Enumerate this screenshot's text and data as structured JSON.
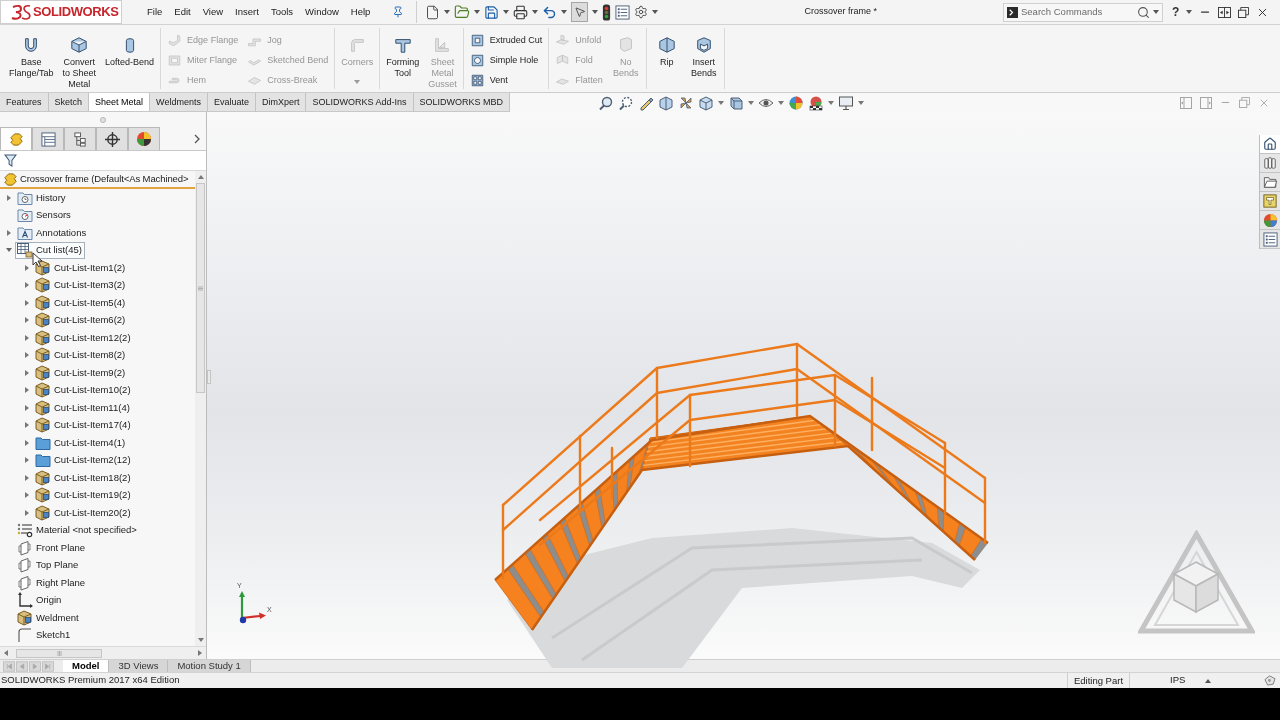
{
  "title_bar": {
    "logo": "SOLIDWORKS",
    "menu": [
      "File",
      "Edit",
      "View",
      "Insert",
      "Tools",
      "Window",
      "Help"
    ],
    "document_title": "Crossover frame *",
    "search": {
      "placeholder": "Search Commands"
    },
    "help": "?"
  },
  "ribbon": {
    "groups": [
      {
        "columns": [
          {
            "kind": "large",
            "label": "Base\nFlange/Tab",
            "disabled": false,
            "dropdown": false
          },
          {
            "kind": "large",
            "label": "Convert\nto Sheet\nMetal",
            "disabled": false,
            "dropdown": false
          },
          {
            "kind": "large",
            "label": "Lofted-Bend",
            "disabled": false,
            "dropdown": false
          }
        ]
      },
      {
        "columns": [
          {
            "kind": "stack",
            "items": [
              {
                "label": "Edge Flange",
                "disabled": true
              },
              {
                "label": "Miter Flange",
                "disabled": true
              },
              {
                "label": "Hem",
                "disabled": true
              }
            ]
          },
          {
            "kind": "stack",
            "items": [
              {
                "label": "Jog",
                "disabled": true
              },
              {
                "label": "Sketched Bend",
                "disabled": true
              },
              {
                "label": "Cross-Break",
                "disabled": true
              }
            ]
          }
        ]
      },
      {
        "columns": [
          {
            "kind": "large",
            "label": "Corners",
            "disabled": true,
            "dropdown": true
          }
        ]
      },
      {
        "columns": [
          {
            "kind": "large",
            "label": "Forming\nTool",
            "disabled": false,
            "dropdown": false
          },
          {
            "kind": "large",
            "label": "Sheet\nMetal\nGusset",
            "disabled": true,
            "dropdown": false
          }
        ]
      },
      {
        "columns": [
          {
            "kind": "stack",
            "items": [
              {
                "label": "Extruded Cut",
                "disabled": false
              },
              {
                "label": "Simple Hole",
                "disabled": false
              },
              {
                "label": "Vent",
                "disabled": false
              }
            ]
          }
        ]
      },
      {
        "columns": [
          {
            "kind": "stack",
            "items": [
              {
                "label": "Unfold",
                "disabled": true
              },
              {
                "label": "Fold",
                "disabled": true
              },
              {
                "label": "Flatten",
                "disabled": true
              }
            ]
          },
          {
            "kind": "large",
            "label": "No\nBends",
            "disabled": true,
            "dropdown": false
          }
        ]
      },
      {
        "columns": [
          {
            "kind": "large",
            "label": "Rip",
            "disabled": false,
            "dropdown": false
          },
          {
            "kind": "large",
            "label": "Insert\nBends",
            "disabled": false,
            "dropdown": false
          }
        ]
      }
    ]
  },
  "command_tabs": [
    {
      "label": "Features",
      "selected": false
    },
    {
      "label": "Sketch",
      "selected": false
    },
    {
      "label": "Sheet Metal",
      "selected": true
    },
    {
      "label": "Weldments",
      "selected": false
    },
    {
      "label": "Evaluate",
      "selected": false
    },
    {
      "label": "DimXpert",
      "selected": false
    },
    {
      "label": "SOLIDWORKS Add-Ins",
      "selected": false
    },
    {
      "label": "SOLIDWORKS MBD",
      "selected": false
    }
  ],
  "feature_manager": {
    "panel_tabs": [
      {
        "selected": true
      },
      {
        "selected": false
      },
      {
        "selected": false
      },
      {
        "selected": false
      },
      {
        "selected": false
      }
    ],
    "tree": {
      "root": "Crossover frame (Default<As Machined>",
      "items": [
        {
          "label": "History",
          "kind": "history",
          "expanded": false,
          "highlighted": false
        },
        {
          "label": "Sensors",
          "kind": "sensors",
          "highlighted": false
        },
        {
          "label": "Annotations",
          "kind": "annotations",
          "expanded": false,
          "highlighted": false
        },
        {
          "label": "Cut list(45)",
          "kind": "cut-list",
          "expanded": true,
          "highlighted": true,
          "children": [
            {
              "label": "Cut-List-Item1(2)",
              "kind": "cut-item",
              "expanded": false,
              "highlighted": false
            },
            {
              "label": "Cut-List-Item3(2)",
              "kind": "cut-item",
              "expanded": false,
              "highlighted": false
            },
            {
              "label": "Cut-List-Item5(4)",
              "kind": "cut-item",
              "expanded": false,
              "highlighted": false
            },
            {
              "label": "Cut-List-Item6(2)",
              "kind": "cut-item",
              "expanded": false,
              "highlighted": false
            },
            {
              "label": "Cut-List-Item12(2)",
              "kind": "cut-item",
              "expanded": false,
              "highlighted": false
            },
            {
              "label": "Cut-List-Item8(2)",
              "kind": "cut-item",
              "expanded": false,
              "highlighted": false
            },
            {
              "label": "Cut-List-Item9(2)",
              "kind": "cut-item",
              "expanded": false,
              "highlighted": false
            },
            {
              "label": "Cut-List-Item10(2)",
              "kind": "cut-item",
              "expanded": false,
              "highlighted": false
            },
            {
              "label": "Cut-List-Item11(4)",
              "kind": "cut-item",
              "expanded": false,
              "highlighted": false
            },
            {
              "label": "Cut-List-Item17(4)",
              "kind": "cut-item",
              "expanded": false,
              "highlighted": false
            },
            {
              "label": "Cut-List-Item4(1)",
              "kind": "folder",
              "expanded": false,
              "highlighted": false
            },
            {
              "label": "Cut-List-Item2(12)",
              "kind": "folder",
              "expanded": false,
              "highlighted": false
            },
            {
              "label": "Cut-List-Item18(2)",
              "kind": "cut-item",
              "expanded": false,
              "highlighted": false
            },
            {
              "label": "Cut-List-Item19(2)",
              "kind": "cut-item",
              "expanded": false,
              "highlighted": false
            },
            {
              "label": "Cut-List-Item20(2)",
              "kind": "cut-item",
              "expanded": false,
              "highlighted": false
            }
          ]
        },
        {
          "label": "Material <not specified>",
          "kind": "material",
          "highlighted": false
        },
        {
          "label": "Front Plane",
          "kind": "plane",
          "highlighted": false
        },
        {
          "label": "Top Plane",
          "kind": "plane",
          "highlighted": false
        },
        {
          "label": "Right Plane",
          "kind": "plane",
          "highlighted": false
        },
        {
          "label": "Origin",
          "kind": "origin",
          "highlighted": false
        },
        {
          "label": "Weldment",
          "kind": "weldment",
          "highlighted": false
        },
        {
          "label": "Sketch1",
          "kind": "sketch",
          "highlighted": false
        }
      ]
    }
  },
  "viewport": {
    "task_pane_tabs": [
      {
        "selected": true
      },
      {
        "selected": false
      },
      {
        "selected": false
      },
      {
        "selected": false
      },
      {
        "selected": false
      },
      {
        "selected": false
      }
    ],
    "triad": {
      "y_label": "Y",
      "x_label": "X"
    }
  },
  "bottom_tabs": [
    {
      "label": "Model",
      "selected": true
    },
    {
      "label": "3D Views",
      "selected": false
    },
    {
      "label": "Motion Study 1",
      "selected": false
    }
  ],
  "status_bar": {
    "product": "SOLIDWORKS Premium 2017 x64 Edition",
    "mode": "Editing Part",
    "units": "IPS"
  }
}
